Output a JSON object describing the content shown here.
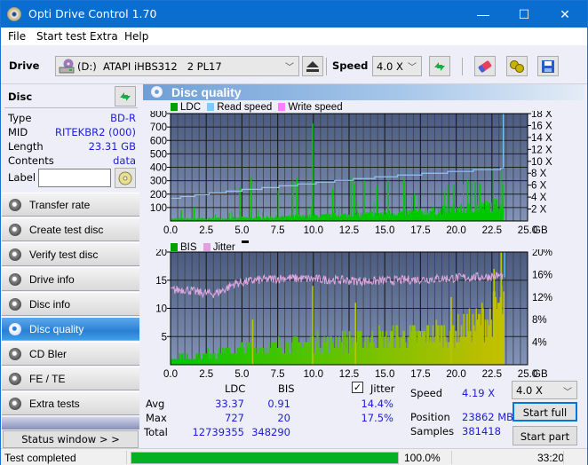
{
  "window": {
    "title": "Opti Drive Control 1.70",
    "minimize": "—",
    "maximize": "☐",
    "close": "✕"
  },
  "menu": [
    "File",
    "Start test",
    "Extra",
    "Help"
  ],
  "toolbar": {
    "drive_label": "Drive",
    "drive_value": "(D:)  ATAPI iHBS312   2 PL17",
    "speed_label": "Speed",
    "speed_value": "4.0 X",
    "icons": [
      "eject-icon",
      "refresh-icon",
      "erase-icon",
      "settings-icon",
      "save-icon"
    ]
  },
  "disc": {
    "header": "Disc",
    "fields": [
      {
        "key": "Type",
        "value": "BD-R"
      },
      {
        "key": "MID",
        "value": "RITEKBR2 (000)"
      },
      {
        "key": "Length",
        "value": "23.31 GB"
      },
      {
        "key": "Contents",
        "value": "data"
      }
    ],
    "label_key": "Label",
    "label_value": ""
  },
  "nav": [
    {
      "label": "Transfer rate",
      "active": false
    },
    {
      "label": "Create test disc",
      "active": false
    },
    {
      "label": "Verify test disc",
      "active": false
    },
    {
      "label": "Drive info",
      "active": false
    },
    {
      "label": "Disc info",
      "active": false
    },
    {
      "label": "Disc quality",
      "active": true
    },
    {
      "label": "CD Bler",
      "active": false
    },
    {
      "label": "FE / TE",
      "active": false
    },
    {
      "label": "Extra tests",
      "active": false
    }
  ],
  "status_window_button": "Status window > >",
  "panel_title": "Disc quality",
  "chart_data": [
    {
      "type": "area",
      "title": "LDC / Read speed",
      "legend": [
        {
          "name": "LDC",
          "color": "#00a000"
        },
        {
          "name": "Read speed",
          "color": "#80c8ff"
        },
        {
          "name": "Write speed",
          "color": "#ff80ff"
        }
      ],
      "legend_placement": "top-left",
      "xlim": [
        0,
        25
      ],
      "xticks": [
        "0.0",
        "2.5",
        "5.0",
        "7.5",
        "10.0",
        "12.5",
        "15.0",
        "17.5",
        "20.0",
        "22.5",
        "25.0"
      ],
      "xunit": "GB",
      "ylim": [
        0,
        800
      ],
      "yticks": [
        "100",
        "200",
        "300",
        "400",
        "500",
        "600",
        "700",
        "800"
      ],
      "y2lim": [
        0,
        18
      ],
      "y2ticks": [
        "2 X",
        "4 X",
        "6 X",
        "8 X",
        "10 X",
        "12 X",
        "14 X",
        "16 X",
        "18 X"
      ],
      "grid": true,
      "ldc_baseline": [
        [
          0,
          15
        ],
        [
          2.5,
          18
        ],
        [
          5,
          22
        ],
        [
          7.5,
          28
        ],
        [
          10,
          35
        ],
        [
          12.5,
          45
        ],
        [
          15,
          55
        ],
        [
          17.5,
          65
        ],
        [
          20,
          85
        ],
        [
          22.5,
          110
        ],
        [
          23.3,
          130
        ]
      ],
      "ldc_spikes": [
        [
          0.7,
          80
        ],
        [
          1.6,
          100
        ],
        [
          4.8,
          250
        ],
        [
          5.6,
          320
        ],
        [
          7.5,
          230
        ],
        [
          8.5,
          300
        ],
        [
          8.8,
          320
        ],
        [
          9.9,
          727
        ],
        [
          11.3,
          240
        ],
        [
          12.6,
          330
        ],
        [
          12.8,
          280
        ],
        [
          13.5,
          300
        ],
        [
          14.4,
          260
        ],
        [
          15.2,
          300
        ],
        [
          16.3,
          310
        ],
        [
          19.8,
          270
        ],
        [
          21.3,
          300
        ],
        [
          21.6,
          280
        ],
        [
          22.8,
          160
        ],
        [
          23.2,
          270
        ]
      ],
      "read_speed": [
        [
          0,
          3.8
        ],
        [
          0.7,
          4.1
        ],
        [
          1.7,
          4.4
        ],
        [
          2.7,
          4.7
        ],
        [
          3.9,
          5.0
        ],
        [
          5.0,
          5.3
        ],
        [
          6.4,
          5.6
        ],
        [
          7.6,
          5.9
        ],
        [
          8.9,
          6.2
        ],
        [
          10.2,
          6.5
        ],
        [
          11.5,
          6.8
        ],
        [
          12.8,
          7.1
        ],
        [
          14.3,
          7.4
        ],
        [
          15.9,
          7.7
        ],
        [
          17.6,
          8.0
        ],
        [
          19.4,
          8.3
        ],
        [
          21.2,
          8.6
        ],
        [
          23.1,
          8.9
        ],
        [
          23.3,
          18
        ]
      ]
    },
    {
      "type": "area",
      "title": "BIS / Jitter",
      "legend": [
        {
          "name": "BIS",
          "color": "#00a000"
        },
        {
          "name": "Jitter",
          "color": "#e0a0e0"
        }
      ],
      "legend_placement": "top-left",
      "xlim": [
        0,
        25
      ],
      "xticks": [
        "0.0",
        "2.5",
        "5.0",
        "7.5",
        "10.0",
        "12.5",
        "15.0",
        "17.5",
        "20.0",
        "22.5",
        "25.0"
      ],
      "xunit": "GB",
      "ylim": [
        0,
        20
      ],
      "yticks": [
        "5",
        "10",
        "15",
        "20"
      ],
      "y2lim": [
        0,
        20
      ],
      "y2ticks": [
        "4%",
        "8%",
        "12%",
        "16%",
        "20%"
      ],
      "grid": true,
      "bis_level": [
        [
          0,
          1.2
        ],
        [
          2.5,
          2
        ],
        [
          5,
          3
        ],
        [
          7.5,
          3.5
        ],
        [
          10,
          4
        ],
        [
          12.5,
          4.5
        ],
        [
          15,
          5
        ],
        [
          17.5,
          5.5
        ],
        [
          20,
          6.5
        ],
        [
          22.5,
          9
        ],
        [
          23.3,
          12
        ]
      ],
      "bis_spikes": [
        [
          5.7,
          8
        ],
        [
          9.9,
          14
        ],
        [
          12.9,
          11
        ],
        [
          19.6,
          12
        ],
        [
          22.6,
          17
        ],
        [
          23.1,
          20
        ]
      ],
      "jitter_pct": [
        [
          0,
          13.2
        ],
        [
          1,
          13.4
        ],
        [
          2,
          12.8
        ],
        [
          3,
          12.6
        ],
        [
          3.5,
          13.0
        ],
        [
          4.5,
          14.4
        ],
        [
          6,
          15.0
        ],
        [
          8,
          15.4
        ],
        [
          10,
          15.2
        ],
        [
          12,
          15.0
        ],
        [
          14,
          14.8
        ],
        [
          16,
          15.0
        ],
        [
          18,
          15.2
        ],
        [
          20,
          15.4
        ],
        [
          22,
          15.6
        ],
        [
          23.3,
          15.8
        ]
      ]
    }
  ],
  "stats": {
    "col_ldc": "LDC",
    "col_bis": "BIS",
    "jitter_label": "Jitter",
    "jitter_checked": true,
    "rows": [
      {
        "label": "Avg",
        "ldc": "33.37",
        "bis": "0.91",
        "jitter": "14.4%"
      },
      {
        "label": "Max",
        "ldc": "727",
        "bis": "20",
        "jitter": "17.5%"
      },
      {
        "label": "Total",
        "ldc": "12739355",
        "bis": "348290",
        "jitter": ""
      }
    ],
    "speed_label": "Speed",
    "speed_value": "4.19 X",
    "position_label": "Position",
    "position_value": "23862 MB",
    "samples_label": "Samples",
    "samples_value": "381418",
    "speed_select": "4.0 X",
    "start_full": "Start full",
    "start_part": "Start part"
  },
  "statusbar": {
    "text": "Test completed",
    "progress": 1.0,
    "percent": "100.0%",
    "time": "33:20"
  }
}
